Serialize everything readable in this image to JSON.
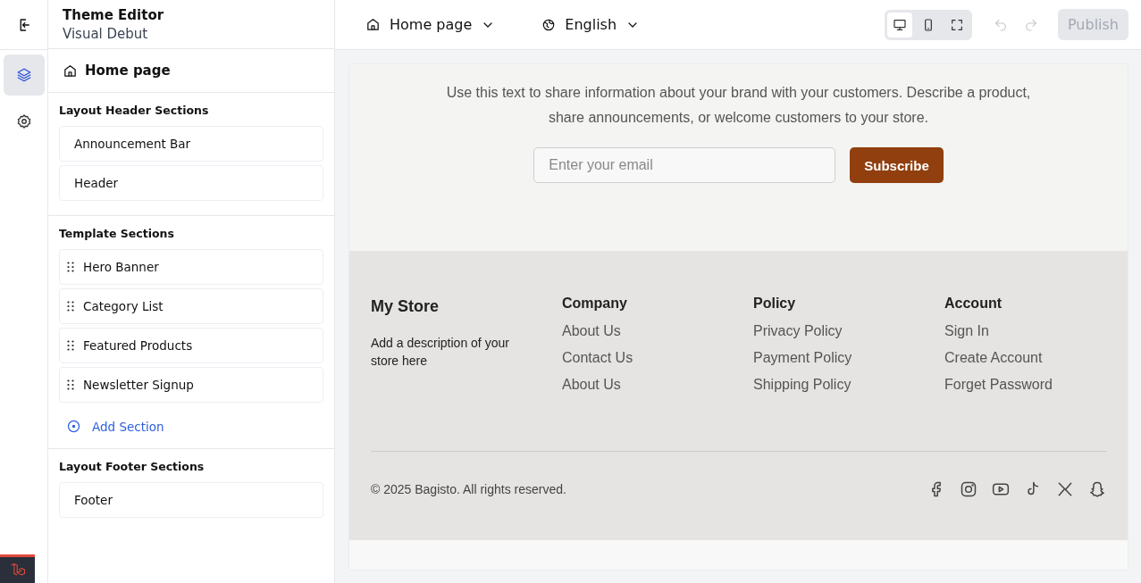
{
  "rail": {
    "items": [
      {
        "kind": "layers",
        "selected": true
      },
      {
        "kind": "settings",
        "selected": false
      }
    ]
  },
  "app": {
    "title": "Theme Editor",
    "subtitle": "Visual Debut"
  },
  "toolbar": {
    "page": "Home page",
    "language": "English",
    "devices": [
      {
        "kind": "desktop",
        "selected": true
      },
      {
        "kind": "mobile",
        "selected": false
      },
      {
        "kind": "fullscreen",
        "selected": false
      }
    ],
    "publish": {
      "label": "Publish",
      "disabled": true
    }
  },
  "sidebar": {
    "page": "Home page",
    "groups": [
      {
        "title": "Layout Header Sections",
        "draggable": false,
        "items": [
          "Announcement Bar",
          "Header"
        ]
      },
      {
        "title": "Template Sections",
        "draggable": true,
        "items": [
          "Hero Banner",
          "Category List",
          "Featured Products",
          "Newsletter Signup"
        ],
        "add_label": "Add Section"
      },
      {
        "title": "Layout Footer Sections",
        "draggable": false,
        "items": [
          "Footer"
        ]
      }
    ]
  },
  "preview": {
    "newsletter": {
      "text": "Use this text to share information about your brand with your customers. Describe a product, share announcements, or welcome customers to your store.",
      "placeholder": "Enter your email",
      "button": "Subscribe"
    },
    "footer": {
      "store": "My Store",
      "description": "Add a description of your store here",
      "columns": [
        {
          "title": "Company",
          "links": [
            "About Us",
            "Contact Us",
            "About Us"
          ]
        },
        {
          "title": "Policy",
          "links": [
            "Privacy Policy",
            "Payment Policy",
            "Shipping Policy"
          ]
        },
        {
          "title": "Account",
          "links": [
            "Sign In",
            "Create Account",
            "Forget Password"
          ]
        }
      ],
      "copyright": "© 2025 Bagisto. All rights reserved.",
      "social": [
        {
          "kind": "facebook"
        },
        {
          "kind": "instagram"
        },
        {
          "kind": "youtube"
        },
        {
          "kind": "tiktok"
        },
        {
          "kind": "x"
        },
        {
          "kind": "snapchat"
        }
      ]
    }
  }
}
